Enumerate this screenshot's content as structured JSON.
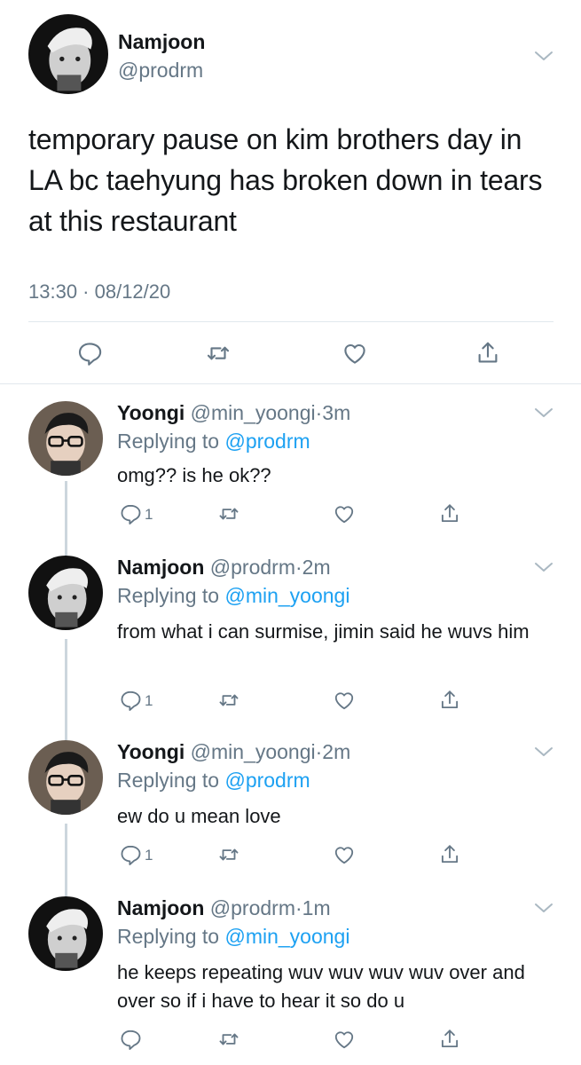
{
  "main": {
    "name": "Namjoon",
    "handle": "@prodrm",
    "text": "temporary pause on kim brothers day in LA bc taehyung has broken down in tears at this restaurant",
    "timestamp": "13:30 · 08/12/20",
    "icons": [
      "reply-icon",
      "retweet-icon",
      "like-icon",
      "share-icon"
    ]
  },
  "replies": [
    {
      "name": "Yoongi",
      "handle": "@min_yoongi",
      "time": "3m",
      "replying_label": "Replying to",
      "replying_to": "@prodrm",
      "text": "omg?? is he ok??",
      "reply_count": "1"
    },
    {
      "name": "Namjoon",
      "handle": "@prodrm",
      "time": "2m",
      "replying_label": "Replying to",
      "replying_to": "@min_yoongi",
      "text": "from what i can surmise, jimin said he wuvs him",
      "reply_count": "1"
    },
    {
      "name": "Yoongi",
      "handle": "@min_yoongi",
      "time": "2m",
      "replying_label": "Replying to",
      "replying_to": "@prodrm",
      "text": "ew do u mean love",
      "reply_count": "1"
    },
    {
      "name": "Namjoon",
      "handle": "@prodrm",
      "time": "1m",
      "replying_label": "Replying to",
      "replying_to": "@min_yoongi",
      "text": "he keeps repeating wuv wuv wuv wuv over and over so if i have to hear it so do u",
      "reply_count": ""
    }
  ],
  "colors": {
    "text": "#14171a",
    "secondary": "#657786",
    "link": "#1da1f2",
    "divider": "#e1e8ed",
    "thread_line": "#ccd6dd"
  }
}
